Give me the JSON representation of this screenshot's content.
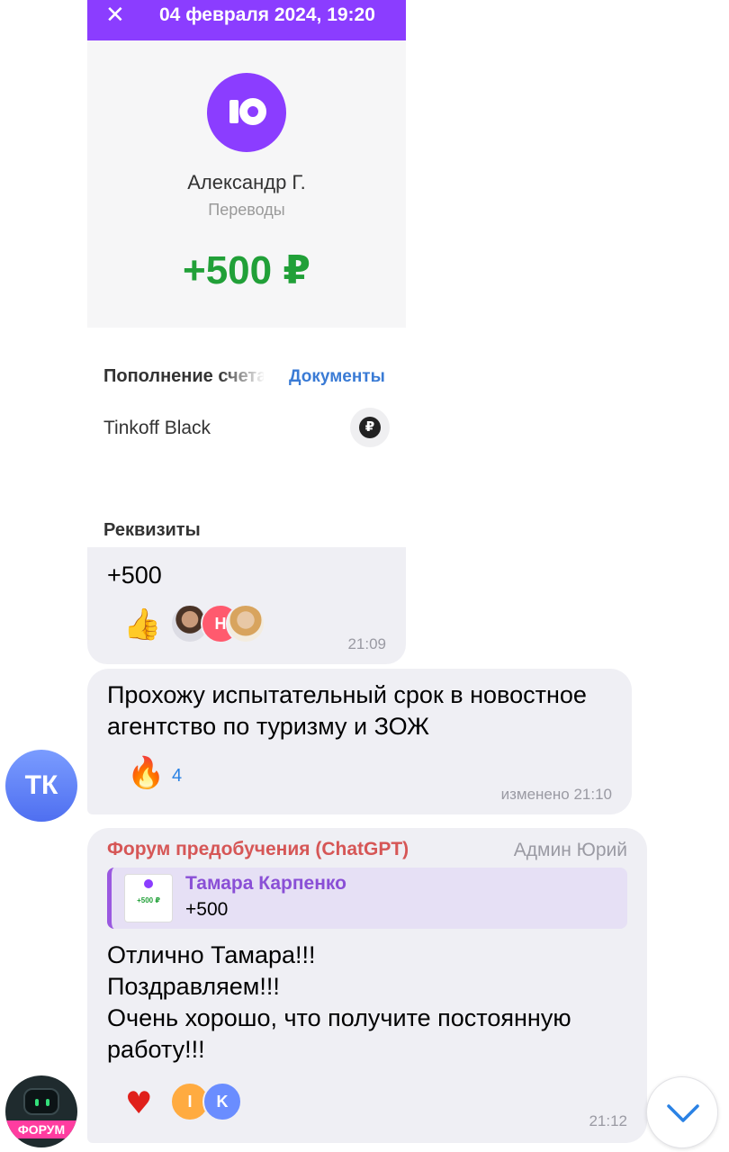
{
  "receipt": {
    "close_icon": "close-icon",
    "date": "04 февраля 2024, 19:20",
    "header_color": "#8b3dff",
    "logo_icon": "yoomoney-logo-icon",
    "sender_name": "Александр Г.",
    "category": "Переводы",
    "amount": "+500 ₽",
    "amount_color": "#21a038",
    "topup_label": "Пополнение счета",
    "documents_link": "Документы",
    "card_name": "Tinkoff Black",
    "ruble_icon": "₽",
    "details_label": "Реквизиты"
  },
  "messages": [
    {
      "text": "+500",
      "reactions": {
        "emoji": "👍",
        "avatars": [
          "photo",
          "Н",
          "photo"
        ]
      },
      "time": "21:09"
    },
    {
      "sender_initials": "ТК",
      "text": "Прохожу испытательный срок в новостное агентство по туризму и ЗОЖ",
      "reactions": {
        "emoji": "🔥",
        "count": "4"
      },
      "time": "изменено 21:10"
    },
    {
      "sender_avatar_label": "ФОРУМ",
      "forwarded_from": "Форум предобучения (ChatGPT)",
      "admin_tag": "Админ Юрий",
      "reply": {
        "name": "Тамара Карпенко",
        "text": "+500",
        "thumb_amount": "+500 ₽"
      },
      "text": "Отлично Тамара!!!\nПоздравляем!!!\nОчень хорошо, что получите постоянную\nработу!!!",
      "reactions": {
        "emoji": "♥",
        "avatars": [
          "I",
          "K"
        ]
      },
      "time": "21:12"
    }
  ],
  "scroll_button_icon": "chevron-down-icon"
}
